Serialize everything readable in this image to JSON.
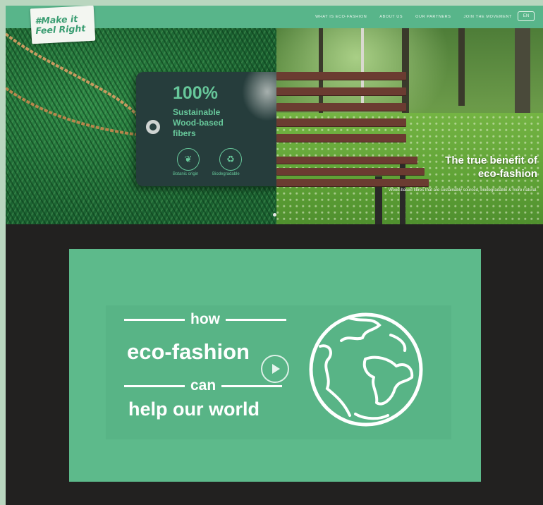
{
  "header": {
    "logo_line1": "#Make it",
    "logo_line2": "Feel Right",
    "nav": [
      "What is eco-fashion",
      "About us",
      "Our partners",
      "Join the movement"
    ],
    "lang_label": "EN"
  },
  "hero_left": {
    "tag_big": "100%",
    "tag_sub": "Sustainable Wood-based fibers",
    "icon1_label": "Botanic origin",
    "icon2_label": "Biodegradable"
  },
  "hero_right": {
    "title_line1": "The true benefit of",
    "title_line2": "eco-fashion",
    "subtitle": "Wood-based fibres that are sustainably sourced, biodegradable & more natural."
  },
  "video": {
    "word1": "how",
    "word2": "eco-fashion",
    "word3": "can",
    "word4": "help our world"
  },
  "colors": {
    "brand_green": "#58b58a",
    "video_green": "#5dba8b",
    "tag_dark": "#263d3c",
    "page_dark": "#222120"
  }
}
